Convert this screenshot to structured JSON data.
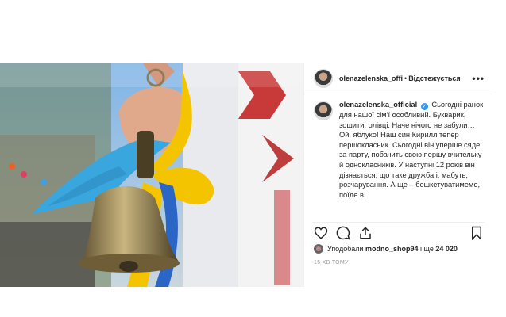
{
  "post": {
    "username_short": "olenazelenska_offi",
    "separator": "•",
    "follow_label": "Відстежується",
    "more_label": "•••",
    "caption_username": "olenazelenska_official",
    "verified_mark": "✓",
    "caption_text": "Сьогодні ранок для нашої сім'ї особливий. Букварик, зошити, олівці. Наче нічого не забули… Ой, яблуко! Наш син Кирилл тепер першокласник. Сьогодні він уперше сяде за парту, побачить свою першу вчительку й однокласників. У наступні 12 років він дізнається, що таке дружба і, мабуть, розчарування. А ще – бешкетуватимемо, поїде в",
    "likes_prefix": "Уподобали",
    "likes_user": "modno_shop94",
    "likes_middle": "і ще",
    "likes_count": "24 020",
    "timestamp": "15 ХВ ТОМУ"
  },
  "colors": {
    "ribbon_blue": "#3aa6de",
    "ribbon_yellow": "#f5c400",
    "bell": "#9c8a5c",
    "verified": "#3897f0"
  },
  "icons": [
    "heart-icon",
    "comment-icon",
    "share-icon",
    "bookmark-icon",
    "more-icon"
  ]
}
